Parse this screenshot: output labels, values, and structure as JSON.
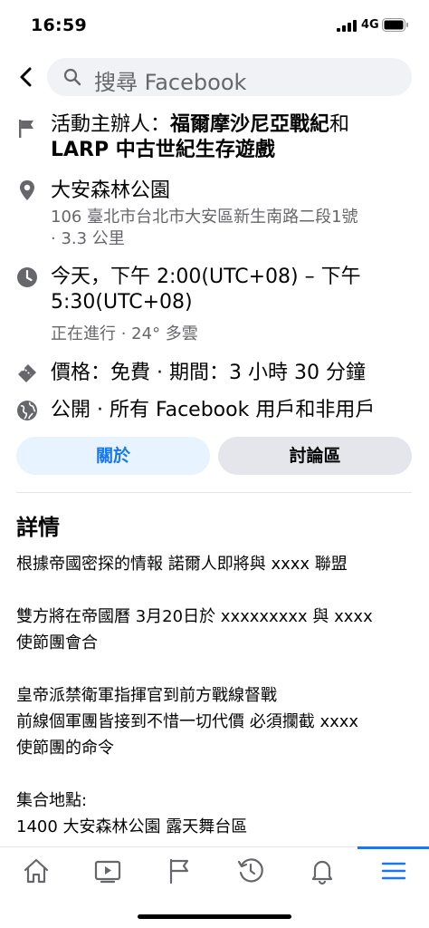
{
  "status_bar": {
    "time": "16:59",
    "network": "4G"
  },
  "search": {
    "placeholder": "搜尋 Facebook"
  },
  "event": {
    "organizer_prefix": "活動主辦人：",
    "organizer_name_line1": "福爾摩沙尼亞戰紀",
    "organizer_connector": "和",
    "organizer_name_line2": "LARP 中古世紀生存遊戲",
    "location_name": "大安森林公園",
    "location_address_line1": "106 臺北市台北市大安區新生南路二段1號",
    "location_address_line2": "· 3.3 公里",
    "time_line1": "今天，下午 2:00(UTC+08) – 下午",
    "time_line2": "5:30(UTC+08)",
    "time_status": "正在進行 · 24° 多雲",
    "price": "價格：免費 · 期間：3 小時 30 分鐘",
    "privacy": "公開 · 所有 Facebook 用戶和非用戶"
  },
  "tabs": {
    "about": "關於",
    "discussion": "討論區"
  },
  "details": {
    "heading": "詳情",
    "lines": [
      "根據帝國密探的情報 諾爾人即將與 xxxx 聯盟",
      "",
      "雙方將在帝國曆 3月20日於 xxxxxxxxx 與 xxxx",
      "使節團會合",
      "",
      "皇帝派禁衛軍指揮官到前方戰線督戰",
      "前線個軍團皆接到不惜一切代價 必須攔截 xxxx",
      "使節團的命令",
      "",
      "集合地點:",
      "1400 大安森林公園 露天舞台區"
    ]
  },
  "tabbar": {
    "items": [
      "home-icon",
      "video-icon",
      "flag-icon",
      "clock-icon",
      "bell-icon",
      "menu-icon"
    ],
    "active_index": 5
  },
  "colors": {
    "accent": "#1877f2",
    "secondary_text": "#65676b",
    "icon_gray": "#65676b"
  }
}
